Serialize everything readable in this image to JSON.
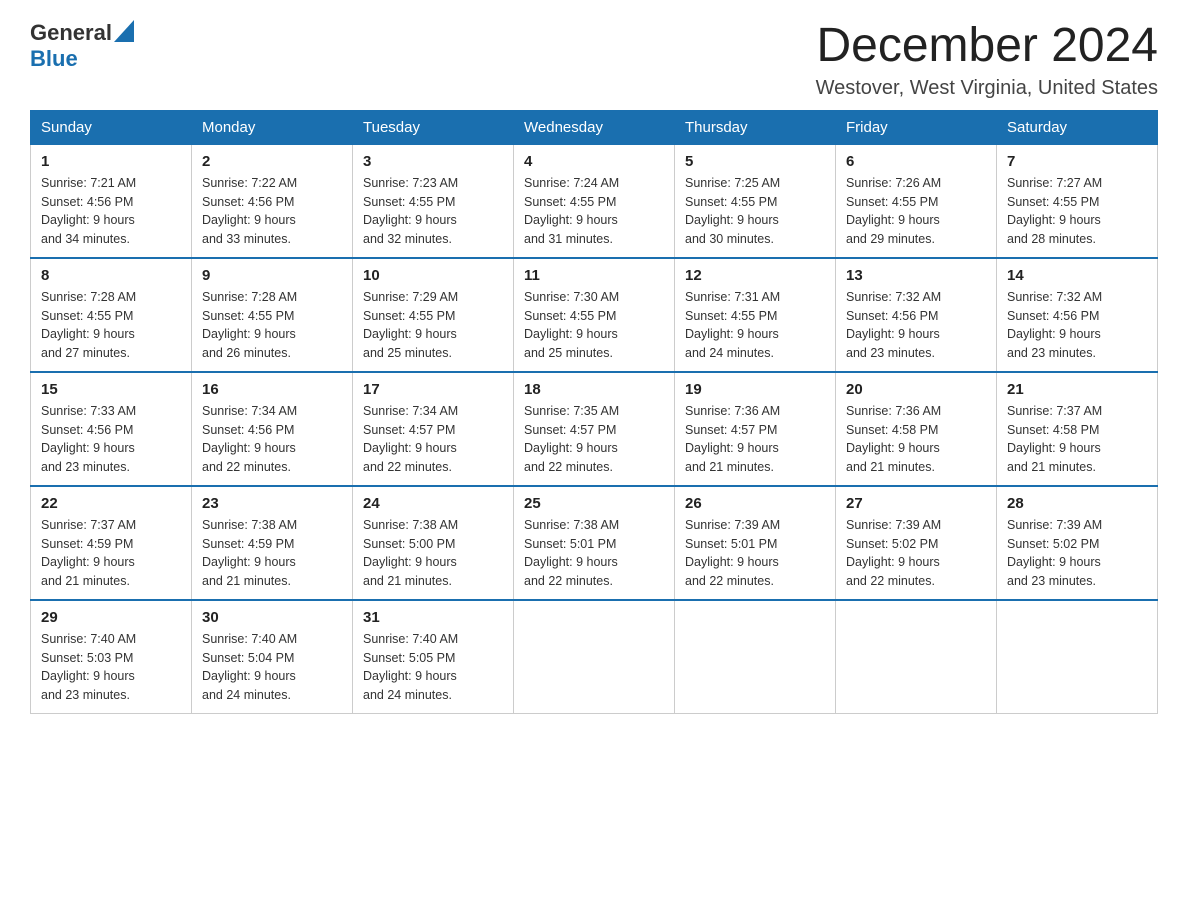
{
  "logo": {
    "general": "General",
    "blue": "Blue",
    "aria": "GeneralBlue logo"
  },
  "title": "December 2024",
  "subtitle": "Westover, West Virginia, United States",
  "weekdays": [
    "Sunday",
    "Monday",
    "Tuesday",
    "Wednesday",
    "Thursday",
    "Friday",
    "Saturday"
  ],
  "weeks": [
    [
      {
        "day": "1",
        "sunrise": "7:21 AM",
        "sunset": "4:56 PM",
        "daylight": "9 hours and 34 minutes."
      },
      {
        "day": "2",
        "sunrise": "7:22 AM",
        "sunset": "4:56 PM",
        "daylight": "9 hours and 33 minutes."
      },
      {
        "day": "3",
        "sunrise": "7:23 AM",
        "sunset": "4:55 PM",
        "daylight": "9 hours and 32 minutes."
      },
      {
        "day": "4",
        "sunrise": "7:24 AM",
        "sunset": "4:55 PM",
        "daylight": "9 hours and 31 minutes."
      },
      {
        "day": "5",
        "sunrise": "7:25 AM",
        "sunset": "4:55 PM",
        "daylight": "9 hours and 30 minutes."
      },
      {
        "day": "6",
        "sunrise": "7:26 AM",
        "sunset": "4:55 PM",
        "daylight": "9 hours and 29 minutes."
      },
      {
        "day": "7",
        "sunrise": "7:27 AM",
        "sunset": "4:55 PM",
        "daylight": "9 hours and 28 minutes."
      }
    ],
    [
      {
        "day": "8",
        "sunrise": "7:28 AM",
        "sunset": "4:55 PM",
        "daylight": "9 hours and 27 minutes."
      },
      {
        "day": "9",
        "sunrise": "7:28 AM",
        "sunset": "4:55 PM",
        "daylight": "9 hours and 26 minutes."
      },
      {
        "day": "10",
        "sunrise": "7:29 AM",
        "sunset": "4:55 PM",
        "daylight": "9 hours and 25 minutes."
      },
      {
        "day": "11",
        "sunrise": "7:30 AM",
        "sunset": "4:55 PM",
        "daylight": "9 hours and 25 minutes."
      },
      {
        "day": "12",
        "sunrise": "7:31 AM",
        "sunset": "4:55 PM",
        "daylight": "9 hours and 24 minutes."
      },
      {
        "day": "13",
        "sunrise": "7:32 AM",
        "sunset": "4:56 PM",
        "daylight": "9 hours and 23 minutes."
      },
      {
        "day": "14",
        "sunrise": "7:32 AM",
        "sunset": "4:56 PM",
        "daylight": "9 hours and 23 minutes."
      }
    ],
    [
      {
        "day": "15",
        "sunrise": "7:33 AM",
        "sunset": "4:56 PM",
        "daylight": "9 hours and 23 minutes."
      },
      {
        "day": "16",
        "sunrise": "7:34 AM",
        "sunset": "4:56 PM",
        "daylight": "9 hours and 22 minutes."
      },
      {
        "day": "17",
        "sunrise": "7:34 AM",
        "sunset": "4:57 PM",
        "daylight": "9 hours and 22 minutes."
      },
      {
        "day": "18",
        "sunrise": "7:35 AM",
        "sunset": "4:57 PM",
        "daylight": "9 hours and 22 minutes."
      },
      {
        "day": "19",
        "sunrise": "7:36 AM",
        "sunset": "4:57 PM",
        "daylight": "9 hours and 21 minutes."
      },
      {
        "day": "20",
        "sunrise": "7:36 AM",
        "sunset": "4:58 PM",
        "daylight": "9 hours and 21 minutes."
      },
      {
        "day": "21",
        "sunrise": "7:37 AM",
        "sunset": "4:58 PM",
        "daylight": "9 hours and 21 minutes."
      }
    ],
    [
      {
        "day": "22",
        "sunrise": "7:37 AM",
        "sunset": "4:59 PM",
        "daylight": "9 hours and 21 minutes."
      },
      {
        "day": "23",
        "sunrise": "7:38 AM",
        "sunset": "4:59 PM",
        "daylight": "9 hours and 21 minutes."
      },
      {
        "day": "24",
        "sunrise": "7:38 AM",
        "sunset": "5:00 PM",
        "daylight": "9 hours and 21 minutes."
      },
      {
        "day": "25",
        "sunrise": "7:38 AM",
        "sunset": "5:01 PM",
        "daylight": "9 hours and 22 minutes."
      },
      {
        "day": "26",
        "sunrise": "7:39 AM",
        "sunset": "5:01 PM",
        "daylight": "9 hours and 22 minutes."
      },
      {
        "day": "27",
        "sunrise": "7:39 AM",
        "sunset": "5:02 PM",
        "daylight": "9 hours and 22 minutes."
      },
      {
        "day": "28",
        "sunrise": "7:39 AM",
        "sunset": "5:02 PM",
        "daylight": "9 hours and 23 minutes."
      }
    ],
    [
      {
        "day": "29",
        "sunrise": "7:40 AM",
        "sunset": "5:03 PM",
        "daylight": "9 hours and 23 minutes."
      },
      {
        "day": "30",
        "sunrise": "7:40 AM",
        "sunset": "5:04 PM",
        "daylight": "9 hours and 24 minutes."
      },
      {
        "day": "31",
        "sunrise": "7:40 AM",
        "sunset": "5:05 PM",
        "daylight": "9 hours and 24 minutes."
      },
      null,
      null,
      null,
      null
    ]
  ],
  "labels": {
    "sunrise": "Sunrise: ",
    "sunset": "Sunset: ",
    "daylight": "Daylight: "
  },
  "colors": {
    "header_bg": "#1a6faf",
    "header_text": "#ffffff",
    "border": "#cccccc",
    "text_dark": "#222222",
    "logo_blue": "#1a6faf"
  }
}
